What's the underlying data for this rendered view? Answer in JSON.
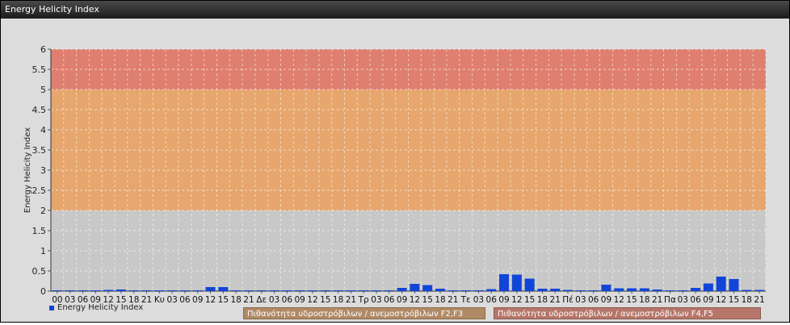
{
  "window": {
    "title": "Energy Helicity Index"
  },
  "legend": {
    "series_label": "Energy Helicity Index"
  },
  "bands": [
    {
      "label": "Πιθανότητα υδροστρόβιλων / ανεμοστρόβιλων F2,F3",
      "from": 2,
      "to": 5,
      "color": "#e8a468"
    },
    {
      "label": "Πιθανότητα υδροστρόβιλων / ανεμοστρόβιλων F4,F5",
      "from": 5,
      "to": 6,
      "color": "#e07b6b"
    }
  ],
  "chart_data": {
    "type": "bar",
    "title": "",
    "xlabel": "",
    "ylabel": "Energy Helicity Index",
    "ylim": [
      0,
      6
    ],
    "yticks": [
      "0",
      "0.5",
      "1",
      "1.5",
      "2",
      "2.5",
      "3",
      "3.5",
      "4",
      "4.5",
      "5",
      "5.5",
      "6"
    ],
    "categories": [
      "00",
      "03",
      "06",
      "09",
      "12",
      "15",
      "18",
      "21",
      "Κυ",
      "03",
      "06",
      "09",
      "12",
      "15",
      "18",
      "21",
      "Δε",
      "03",
      "06",
      "09",
      "12",
      "15",
      "18",
      "21",
      "Τρ",
      "03",
      "06",
      "09",
      "12",
      "15",
      "18",
      "21",
      "Τε",
      "03",
      "06",
      "09",
      "12",
      "15",
      "18",
      "21",
      "Πέ",
      "03",
      "06",
      "09",
      "12",
      "15",
      "18",
      "21",
      "Πα",
      "03",
      "06",
      "09",
      "12",
      "15",
      "18",
      "21"
    ],
    "series": [
      {
        "name": "Energy Helicity Index",
        "color": "#1045d8",
        "values": [
          0.02,
          0.02,
          0.02,
          0.02,
          0.03,
          0.04,
          0.02,
          0.02,
          0.02,
          0.02,
          0.02,
          0.02,
          0.1,
          0.1,
          0.02,
          0.02,
          0.02,
          0.02,
          0.02,
          0.02,
          0.02,
          0.02,
          0.02,
          0.02,
          0.02,
          0.02,
          0.02,
          0.08,
          0.18,
          0.15,
          0.06,
          0.02,
          0.02,
          0.02,
          0.05,
          0.42,
          0.41,
          0.31,
          0.06,
          0.06,
          0.03,
          0.02,
          0.02,
          0.16,
          0.07,
          0.07,
          0.07,
          0.04,
          0.02,
          0.02,
          0.08,
          0.19,
          0.36,
          0.3,
          0.03,
          0.03
        ]
      }
    ],
    "grid": true
  }
}
